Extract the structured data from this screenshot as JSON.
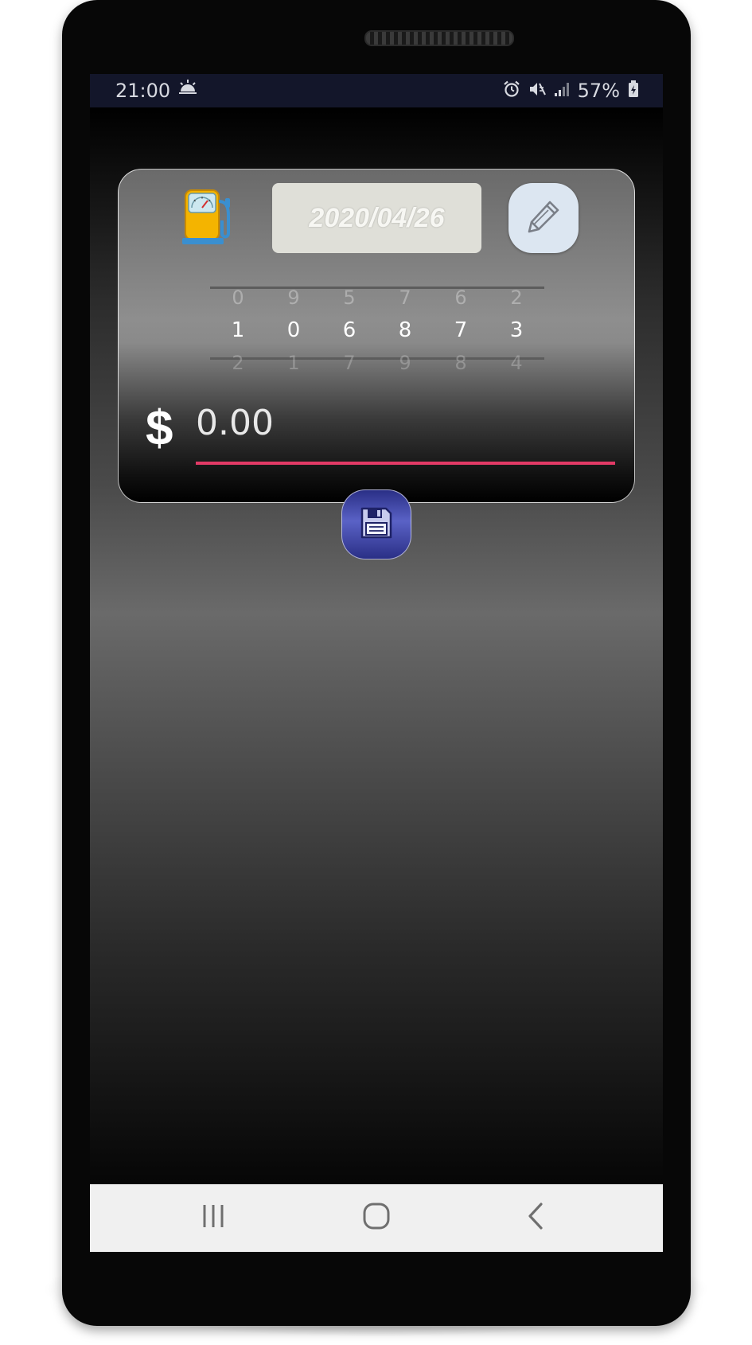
{
  "status_bar": {
    "time": "21:00",
    "weather_icon": "sunrise-icon",
    "alarm_icon": "alarm-icon",
    "mute_icon": "mute-icon",
    "signal_icon": "signal-icon",
    "battery_percent": "57%",
    "battery_icon": "battery-charging-icon"
  },
  "card": {
    "fuel_icon": "gas-pump-icon",
    "date": "2020/04/26",
    "edit_icon": "pencil-icon",
    "odometer": {
      "above": [
        "0",
        "9",
        "5",
        "7",
        "6",
        "2"
      ],
      "selected": [
        "1",
        "0",
        "6",
        "8",
        "7",
        "3"
      ],
      "below": [
        "2",
        "1",
        "7",
        "9",
        "8",
        "4"
      ]
    },
    "currency_symbol": "$",
    "amount_value": "0.00"
  },
  "save_button": {
    "icon": "floppy-disk-icon"
  },
  "nav_bar": {
    "recents_icon": "recents-icon",
    "home_icon": "home-icon",
    "back_icon": "back-icon"
  },
  "colors": {
    "status_bar_bg": "#13162a",
    "accent_underline": "#e23a66",
    "date_box_bg": "#dfdfd8",
    "edit_button_bg": "#dce6f1",
    "save_button_bg": "#4a52b6"
  }
}
